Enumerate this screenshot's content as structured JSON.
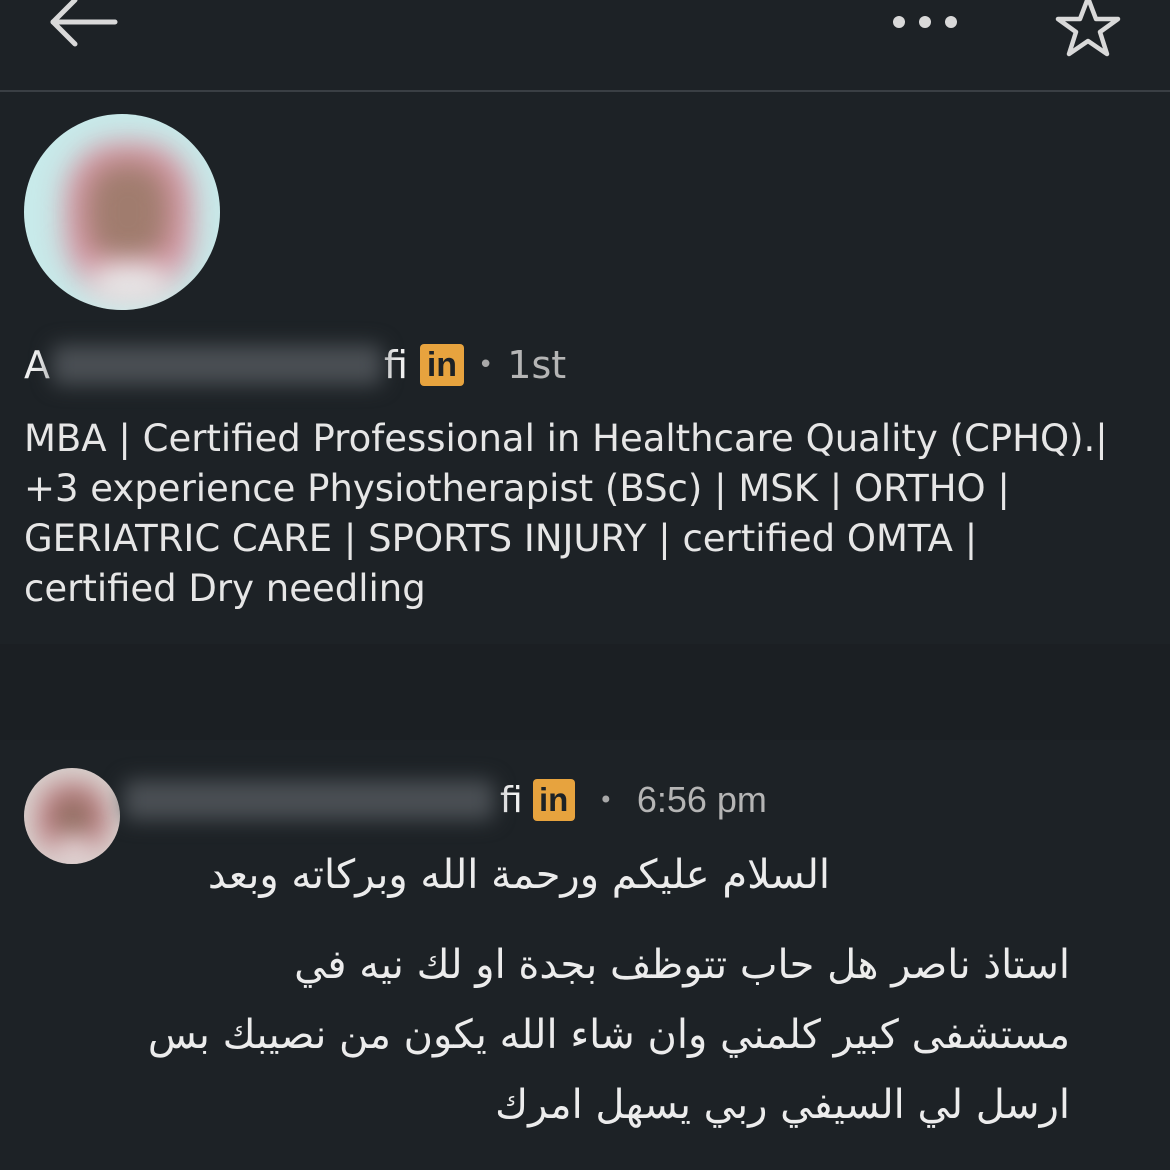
{
  "topbar": {
    "back_icon": "arrow-left-icon",
    "more_icon": "more-horizontal-icon",
    "star_icon": "star-outline-icon"
  },
  "profile": {
    "name_start": "A",
    "name_end": "fi",
    "badge": "in",
    "separator": "•",
    "degree": "1st",
    "headline": "MBA | Certified Professional in Healthcare Quality (CPHQ).| +3 experience Physiotherapist (BSc) | MSK | ORTHO | GERIATRIC CARE | SPORTS INJURY | certified OMTA | certified Dry needling"
  },
  "message": {
    "name_end": "fi",
    "badge": "in",
    "separator": "•",
    "time": "6:56 pm",
    "greeting": "السلام عليكم ورحمة الله وبركاته وبعد",
    "body": "استاذ ناصر هل حاب تتوظف بجدة او لك نيه في مستشفى كبير كلمني وان شاء الله يكون من نصيبك بس ارسل لي السيفي ربي يسهل امرك"
  },
  "colors": {
    "background": "#1d2226",
    "linkedin_badge": "#e7a33e",
    "text": "#e6e6e6",
    "muted": "#b5b5b5"
  }
}
